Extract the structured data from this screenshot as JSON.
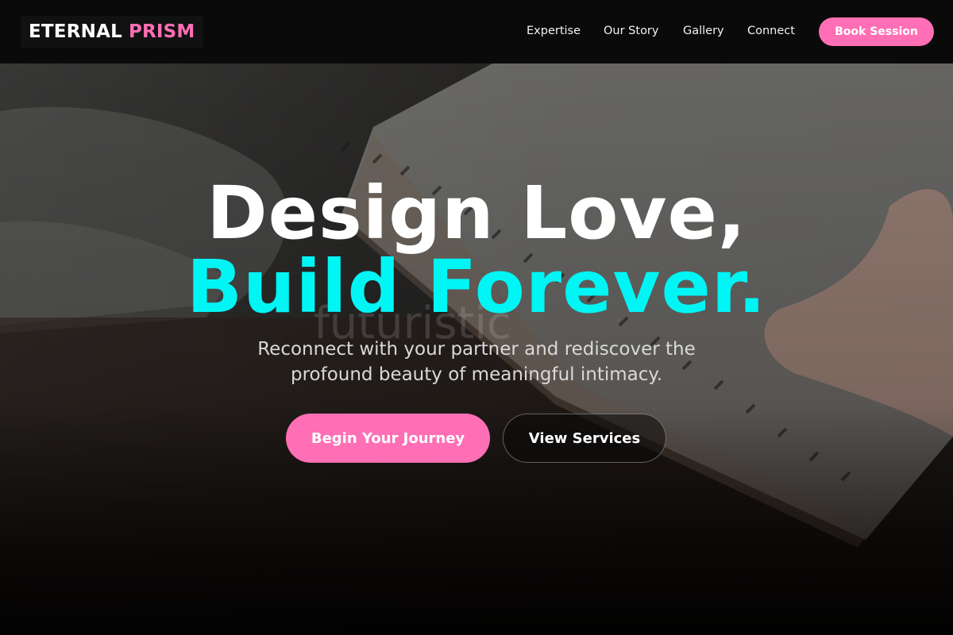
{
  "brand": {
    "name_white": "ETERNAL",
    "name_pink": "PRISM"
  },
  "nav": {
    "items": [
      {
        "label": "Expertise"
      },
      {
        "label": "Our Story"
      },
      {
        "label": "Gallery"
      },
      {
        "label": "Connect"
      }
    ],
    "cta_label": "Book Session"
  },
  "hero": {
    "title_line1": "Design Love,",
    "title_line2": "Build Forever.",
    "ghost_text": "futuristic",
    "subtitle_line1": "Reconnect with your partner and rediscover the",
    "subtitle_line2": "profound beauty of meaningful intimacy.",
    "primary_button": "Begin Your Journey",
    "secondary_button": "View Services"
  },
  "colors": {
    "accent_pink": "#ff6fb5",
    "accent_cyan": "#00f5f5",
    "header_bg": "#0a0a0a"
  }
}
